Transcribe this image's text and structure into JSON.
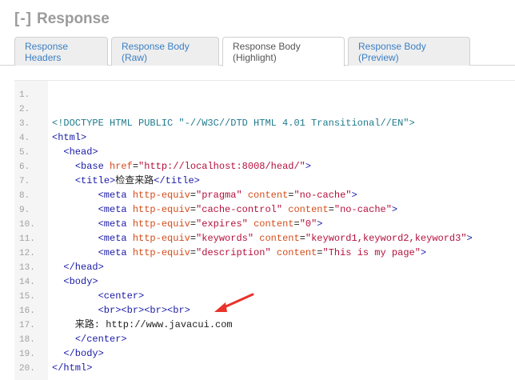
{
  "section": {
    "toggle": "[-]",
    "title": "Response"
  },
  "tabs": [
    {
      "label": "Response Headers",
      "active": false
    },
    {
      "label": "Response Body (Raw)",
      "active": false
    },
    {
      "label": "Response Body (Highlight)",
      "active": true
    },
    {
      "label": "Response Body (Preview)",
      "active": false
    }
  ],
  "code": {
    "line_numbers": [
      "1.",
      "2.",
      "3.",
      "4.",
      "5.",
      "6.",
      "7.",
      "8.",
      "9.",
      "10.",
      "11.",
      "12.",
      "13.",
      "14.",
      "15.",
      "16.",
      "17.",
      "18.",
      "19.",
      "20."
    ],
    "lines": [
      "",
      "",
      "<!DOCTYPE HTML PUBLIC \"-//W3C//DTD HTML 4.01 Transitional//EN\">",
      "<html>",
      "  <head>",
      "    <base href=\"http://localhost:8008/head/\">",
      "    <title>检查来路</title>",
      "        <meta http-equiv=\"pragma\" content=\"no-cache\">",
      "        <meta http-equiv=\"cache-control\" content=\"no-cache\">",
      "        <meta http-equiv=\"expires\" content=\"0\">",
      "        <meta http-equiv=\"keywords\" content=\"keyword1,keyword2,keyword3\">",
      "        <meta http-equiv=\"description\" content=\"This is my page\">",
      "  </head>",
      "  <body>",
      "        <center>",
      "        <br><br><br><br>",
      "    来路: http://www.javacui.com",
      "    </center>",
      "  </body>",
      "</html>"
    ]
  },
  "colors": {
    "tab_link": "#3a7fc4",
    "tag": "#1a1aa6",
    "attr": "#d44d1c",
    "value": "#b5103c",
    "doctype": "#1f7a8c",
    "arrow": "#e8332a"
  }
}
